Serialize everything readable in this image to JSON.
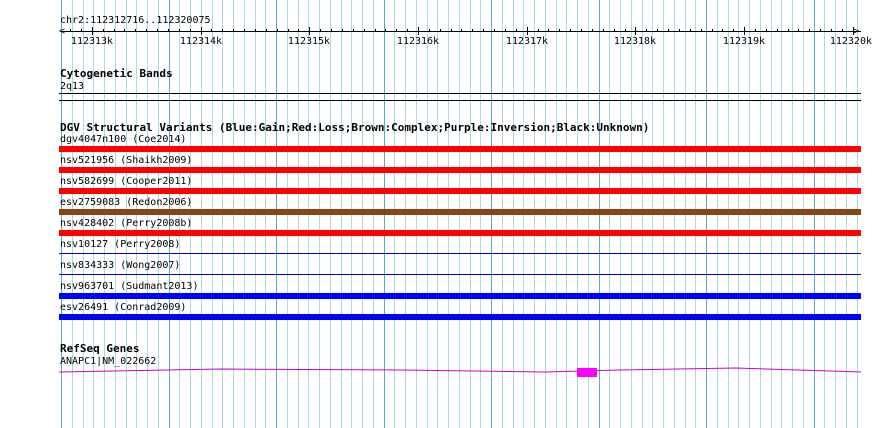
{
  "ruler": {
    "locus": "chr2:112312716..112320075",
    "start": 112312716,
    "end": 112320075,
    "tick_labels": [
      "112313k",
      "112314k",
      "112315k",
      "112316k",
      "112317k",
      "112318k",
      "112319k",
      "112320k"
    ]
  },
  "cyto": {
    "title": "Cytogenetic Bands",
    "band": "2q13"
  },
  "dgv": {
    "title": "DGV Structural Variants (Blue:Gain;Red:Loss;Brown:Complex;Purple:Inversion;Black:Unknown)",
    "variants": [
      {
        "label": "dgv4047n100 (Coe2014)",
        "color": "#ff0000",
        "type": "thick"
      },
      {
        "label": "nsv521956 (Shaikh2009)",
        "color": "#ff0000",
        "type": "thick"
      },
      {
        "label": "nsv582699 (Cooper2011)",
        "color": "#ff0000",
        "type": "thick"
      },
      {
        "label": "esv2759083 (Redon2006)",
        "color": "#8b4513",
        "type": "thick"
      },
      {
        "label": "nsv428402 (Perry2008b)",
        "color": "#ff0000",
        "type": "thick"
      },
      {
        "label": "nsv10127 (Perry2008)",
        "color": "#0000cc",
        "type": "thin"
      },
      {
        "label": "nsv834333 (Wong2007)",
        "color": "#0000cc",
        "type": "thin"
      },
      {
        "label": "nsv963701 (Sudmant2013)",
        "color": "#0000ff",
        "type": "thick"
      },
      {
        "label": "esv26491 (Conrad2009)",
        "color": "#0000ff",
        "type": "thick"
      }
    ]
  },
  "refseq": {
    "title": "RefSeq Genes",
    "gene": "ANAPC1|NM_022662",
    "line_color": "#cc00cc",
    "exon_color": "#ff00ff"
  },
  "colors": {
    "grid": "#add8e6",
    "grid_alt": "#5fa8c8"
  }
}
